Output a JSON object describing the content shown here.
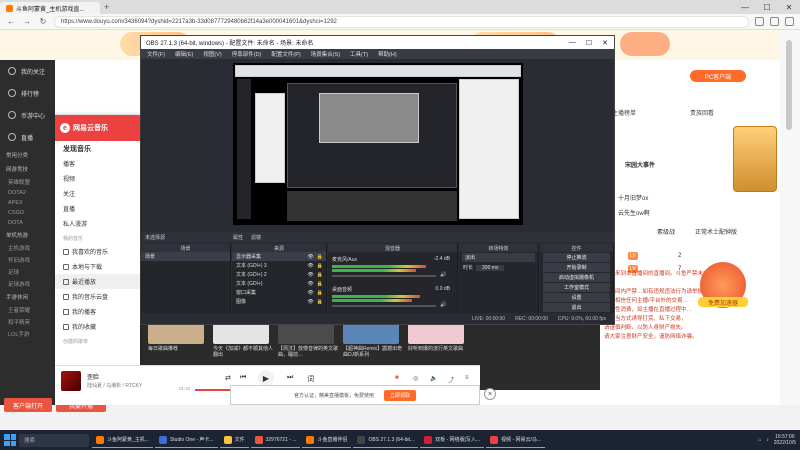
{
  "browser": {
    "tab_title": "斗鱼阿蒙黄_主机游戏直...",
    "new_tab": "+",
    "url": "https://www.douyu.com/3436094?dyshid=2217a3b-33d0877729480b62f14a3e000041601&dyshci=1292",
    "controls": {
      "min": "—",
      "max": "☐",
      "close": "✕"
    }
  },
  "douyu": {
    "nav": [
      {
        "icon": "heart-icon",
        "label": "我的关注"
      },
      {
        "icon": "list-icon",
        "label": "排行榜"
      },
      {
        "icon": "coin-icon",
        "label": "币游中心"
      },
      {
        "icon": "bag-icon",
        "label": "直播"
      }
    ],
    "common_section": "常用分类",
    "subsections": [
      {
        "title": "网游竞技",
        "items": [
          "英雄联盟",
          "DOTA2",
          "APEX",
          "CSGO",
          "DOTA"
        ]
      },
      {
        "title": "单机热游",
        "items": [
          "主机游戏",
          "怀旧游戏",
          "足球",
          "足球游戏"
        ]
      },
      {
        "title": "手游休闲",
        "items": [
          "王者荣耀",
          "和平精英",
          "LOL手游"
        ]
      }
    ],
    "client_button": "客户端打开",
    "start_button": "我要开播",
    "right": {
      "pc_button": "PC客户端",
      "rank_title": "主播榜单",
      "rank_title2": "贵族回看",
      "notice": "宋园大事件",
      "text_b": "十月旧梦ox",
      "text_c": "云先生ow啊",
      "row1": "素级战",
      "row2": "正常术士配钟版",
      "chat_lines": [
        "欢迎来到本直播间的直播间。斗鱼严禁未成年人直播或打赏。",
        "直播间内严禁…如有违规违法行为请举报。",
        "请勿相信任何主播/平台外的交易…",
        "请理性消费，如主播在直播过程中…",
        "不正当方式诱导打赏、私下交易，",
        "请谨慎判断，以防人身财产损失。",
        "请大家注意财产安全，谨防网络诈骗。"
      ],
      "num_a": "2",
      "num_b": "7",
      "speed_label": "免费加速器"
    }
  },
  "music": {
    "app_name": "网易云音乐",
    "items": [
      {
        "label": "发现音乐",
        "bold": true
      },
      {
        "label": "播客"
      },
      {
        "label": "视频"
      },
      {
        "label": "关注"
      },
      {
        "label": "直播"
      },
      {
        "label": "私人漫游"
      }
    ],
    "section_mine": "我的音乐",
    "mine_items": [
      {
        "icon": "heart-icon",
        "label": "我喜欢的音乐"
      },
      {
        "icon": "download-icon",
        "label": "本地与下载"
      },
      {
        "icon": "clock-icon",
        "label": "最近播放",
        "active": true
      },
      {
        "icon": "cloud-icon",
        "label": "我的音乐云盘"
      },
      {
        "icon": "radio-icon",
        "label": "我的播客"
      },
      {
        "icon": "star-icon",
        "label": "我的收藏"
      }
    ],
    "section_created": "创建的歌单",
    "player": {
      "song": "歪脸",
      "artist": "陆仙夏 / 马潮析 / RTCKY",
      "time_now": "01:42",
      "time_total": "03:42",
      "progress": 0.46,
      "mode": "词"
    }
  },
  "obs": {
    "title": "OBS 27.1.3 (64-bit, windows) - 配置文件: 未命名 - 场景: 未命名",
    "menu": [
      "文件(F)",
      "编辑(E)",
      "视图(V)",
      "停靠部件(D)",
      "配置文件(P)",
      "场景集合(S)",
      "工具(T)",
      "帮助(H)"
    ],
    "scene_bar": [
      "未选择源",
      "属性",
      "滤镜"
    ],
    "docks": {
      "scenes": {
        "title": "场景",
        "items": [
          "场景"
        ]
      },
      "sources": {
        "title": "来源",
        "items": [
          "显示器采集",
          "文本 (GDI+) 3",
          "文本 (GDI+) 2",
          "文本 (GDI+)",
          "窗口采集",
          "图像"
        ]
      },
      "mixer": {
        "title": "混音器",
        "tracks": [
          {
            "name": "麦克风/Aux",
            "db": "-2.4 dB",
            "level": 0.9
          },
          {
            "name": "桌面音频",
            "db": "0.0 dB",
            "level": 0.85
          }
        ]
      },
      "transitions": {
        "title": "转场特效",
        "type": "淡出",
        "duration_label": "时长",
        "duration": "300 ms"
      },
      "controls": {
        "title": "控件",
        "buttons": [
          "停止推流",
          "开始录制",
          "启动虚拟摄像机",
          "工作室模式",
          "设置",
          "退出"
        ]
      }
    },
    "status": [
      "LIVE: 00:00:00",
      "REC: 00:00:00",
      "CPU: 9.0%, 60.00 fps"
    ]
  },
  "bottom_overlay": {
    "text_left": "官方认证，精美直播模板，免费使用",
    "button": "立即领取"
  },
  "thumbs": [
    {
      "caption": "每日歌曲推荐"
    },
    {
      "caption": "今天《加减》都不顺其他人翻出"
    },
    {
      "caption": "【周汶】放慢音律的英文歌曲，睡前…"
    },
    {
      "caption": "【超神曲Remix】震撼出奇曲DJ新系列"
    },
    {
      "caption": "好听到爆的流行英文歌曲"
    }
  ],
  "taskbar": {
    "search": "搜索",
    "apps": [
      {
        "label": "斗鱼阿蒙黄_主机...",
        "color": "#ff7a00"
      },
      {
        "label": "Studio One - 声卡...",
        "color": "#3b6fd8"
      },
      {
        "label": "文件",
        "color": "#f6c343"
      },
      {
        "label": "32976721 - ...",
        "color": "#e9553f"
      },
      {
        "label": "斗鱼直播伴侣",
        "color": "#ff7a00"
      },
      {
        "label": "OBS 27.1.3 (64-bit...",
        "color": "#444"
      },
      {
        "label": "双板 - 网络版[写入...",
        "color": "#c23"
      },
      {
        "label": "视频 - 网易云/马...",
        "color": "#ec4141"
      }
    ],
    "time": "16:57:06",
    "date": "2022/10/5"
  },
  "colors": {
    "accent": "#ff7a00",
    "netease": "#ec4141",
    "obs_bg": "#2a2c33"
  }
}
